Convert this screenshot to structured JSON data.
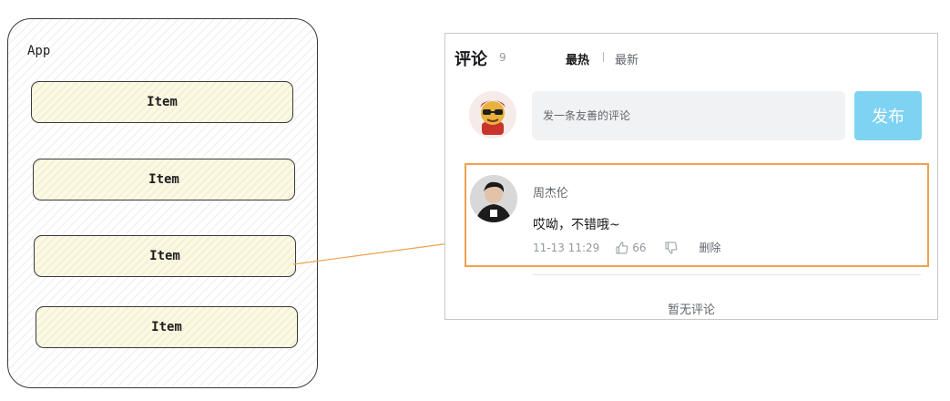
{
  "left_panel": {
    "app_label": "App",
    "items": [
      "Item",
      "Item",
      "Item",
      "Item"
    ]
  },
  "comment_panel": {
    "title": "评论",
    "count": "9",
    "sort_hot": "最热",
    "sort_new": "最新",
    "input_placeholder": "发一条友善的评论",
    "publish_label": "发布",
    "comment": {
      "username": "周杰伦",
      "text": "哎呦，不错哦~",
      "time": "11-13 11:29",
      "likes": "66",
      "delete_label": "删除"
    },
    "footer_text": "暂无评论"
  },
  "colors": {
    "highlight": "#f0a04e",
    "publish_button": "#7fd3f2",
    "arrow": "#f0a04e"
  }
}
